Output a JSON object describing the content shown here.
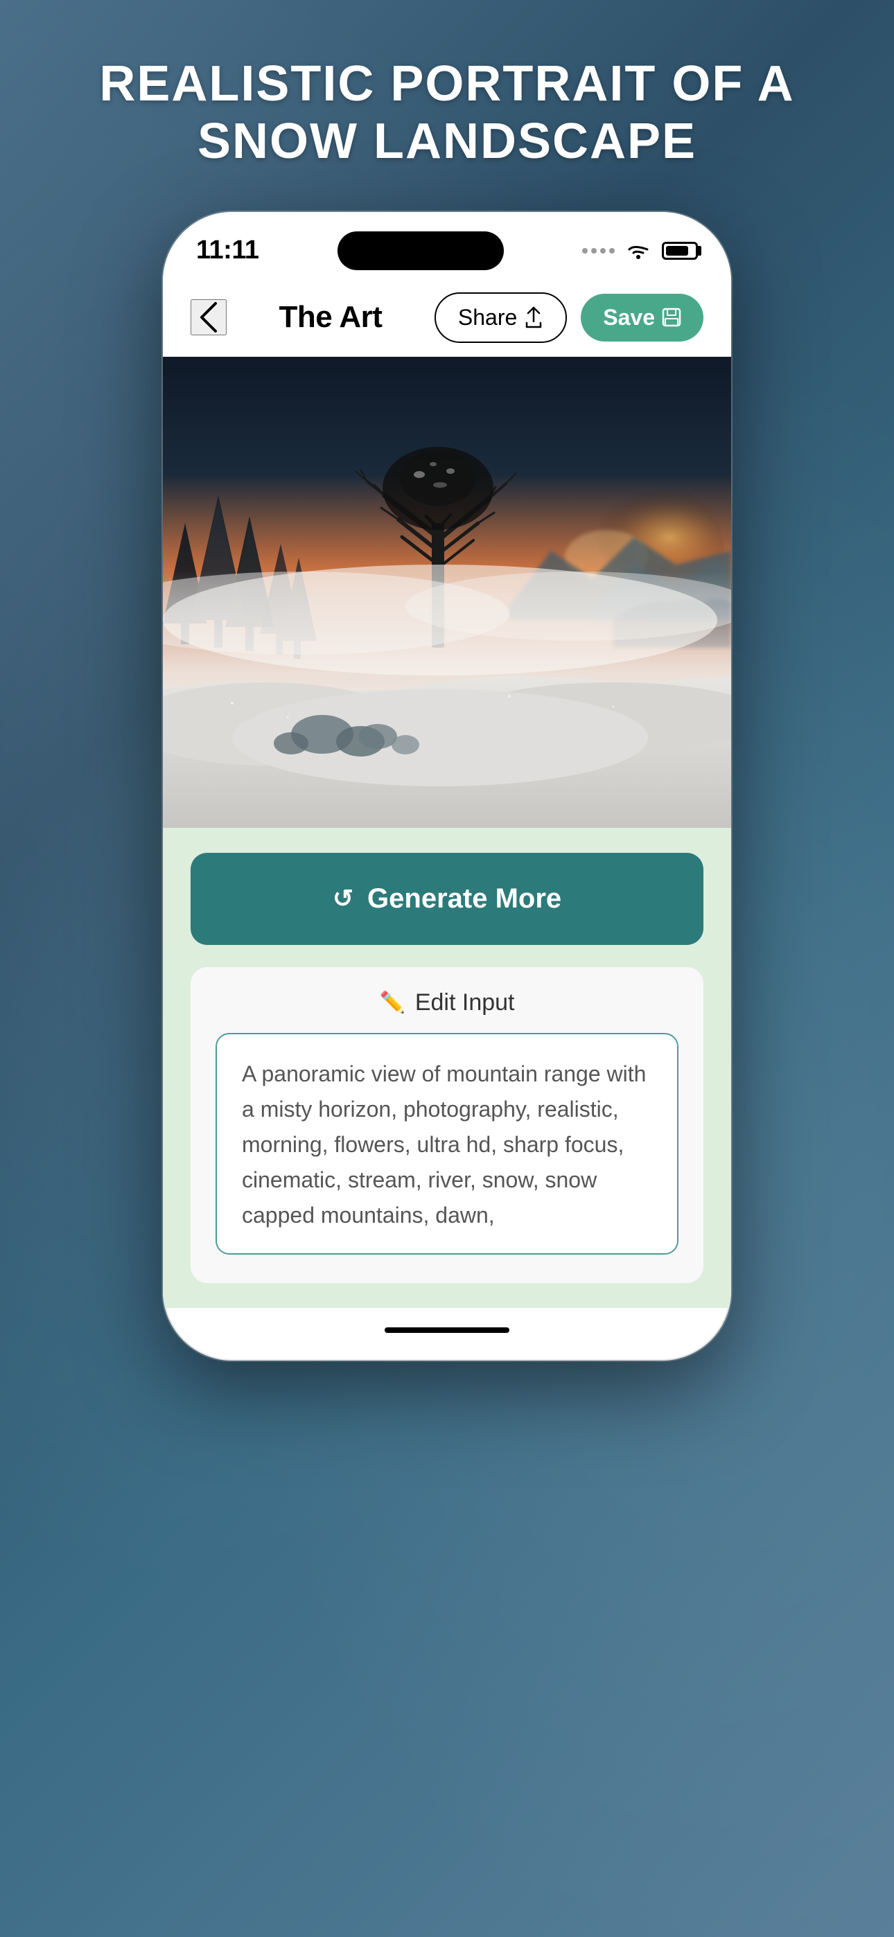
{
  "page": {
    "title": "REALISTIC PORTRAIT OF A SNOW LANDSCAPE",
    "background_gradient_start": "#4a6f8a",
    "background_gradient_end": "#2d5068"
  },
  "status_bar": {
    "time": "11:11",
    "signal_label": "signal",
    "wifi_label": "wifi",
    "battery_label": "battery"
  },
  "nav": {
    "back_label": "back",
    "title": "The Art",
    "share_button": "Share",
    "save_button": "Save"
  },
  "image": {
    "alt": "Realistic snow landscape with misty trees and sunset",
    "description": "A panoramic winter landscape with snow-covered ground, pine trees, a bare tree in center, misty horizon, and warm sunset sky"
  },
  "actions": {
    "generate_more_label": "Generate More",
    "generate_icon": "↺",
    "edit_input_label": "Edit Input",
    "edit_icon": "✏"
  },
  "text_input": {
    "value": "A panoramic view of mountain range with a misty horizon, photography, realistic, morning, flowers, ultra hd, sharp focus, cinematic, stream, river, snow, snow capped mountains, dawn,",
    "placeholder": "Enter your prompt here..."
  },
  "colors": {
    "generate_button_bg": "#2d7a7a",
    "save_button_bg": "#4aa88a",
    "input_border": "#4a9a9a",
    "content_bg": "#ddeedd",
    "edit_section_bg": "#f8f8f8"
  }
}
